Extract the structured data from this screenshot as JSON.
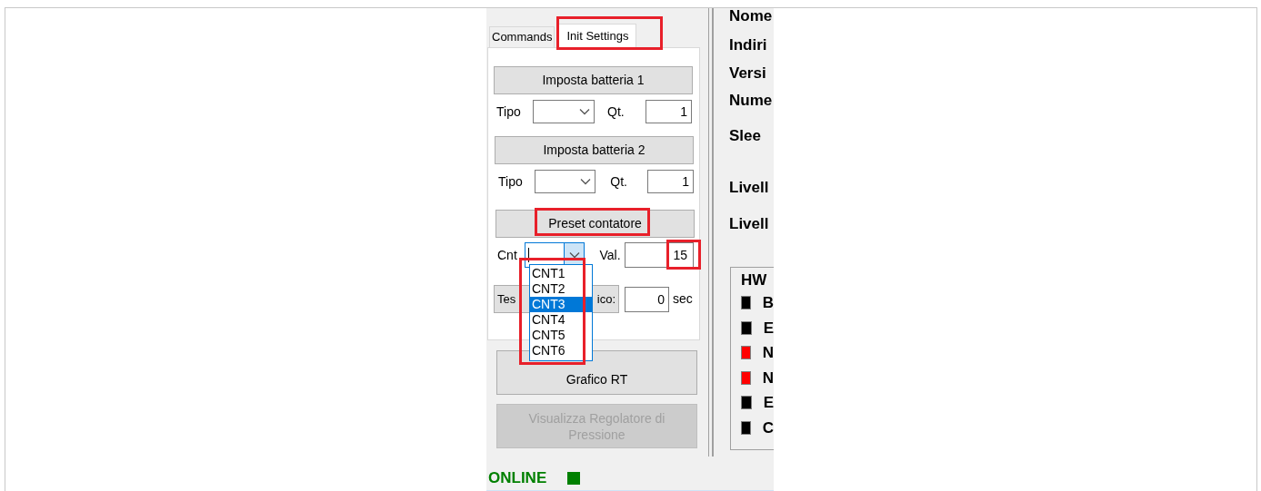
{
  "tabs": [
    {
      "label": "Commands",
      "selected": false
    },
    {
      "label": "Init Settings",
      "selected": true
    }
  ],
  "battery_sections": [
    {
      "button": "Imposta batteria 1",
      "type_label": "Tipo",
      "qty_label": "Qt.",
      "qty_value": "1"
    },
    {
      "button": "Imposta batteria 2",
      "type_label": "Tipo",
      "qty_label": "Qt.",
      "qty_value": "1"
    }
  ],
  "counter": {
    "button": "Preset contatore",
    "cnt_label": "Cnt",
    "val_label": "Val.",
    "value": "15",
    "dropdown_expanded": true,
    "options": [
      {
        "label": "CNT1",
        "selected": false
      },
      {
        "label": "CNT2",
        "selected": false
      },
      {
        "label": "CNT3",
        "selected": true
      },
      {
        "label": "CNT4",
        "selected": false
      },
      {
        "label": "CNT5",
        "selected": false
      },
      {
        "label": "CNT6",
        "selected": false
      }
    ]
  },
  "test_button": {
    "visible_start": "Tes",
    "visible_end": "ico:"
  },
  "period": {
    "value": "0",
    "unit": "sec"
  },
  "buttons": [
    {
      "label": "Grafico RT",
      "disabled": false
    },
    {
      "label": "Visualizza Regolatore di Pressione",
      "disabled": true
    }
  ],
  "status": {
    "label": "ONLINE",
    "color": "#008000"
  },
  "info_labels": [
    "Nome",
    "Indiri",
    "Versi",
    "Nume",
    "Slee",
    "Livell",
    "Livell"
  ],
  "hw_group": {
    "title": "HW",
    "indicators": [
      {
        "label": "B",
        "color": "#000000"
      },
      {
        "label": "E",
        "color": "#000000"
      },
      {
        "label": "N",
        "color": "#ff0000"
      },
      {
        "label": "N",
        "color": "#ff0000"
      },
      {
        "label": "E",
        "color": "#000000"
      },
      {
        "label": "C",
        "color": "#000000"
      }
    ]
  }
}
